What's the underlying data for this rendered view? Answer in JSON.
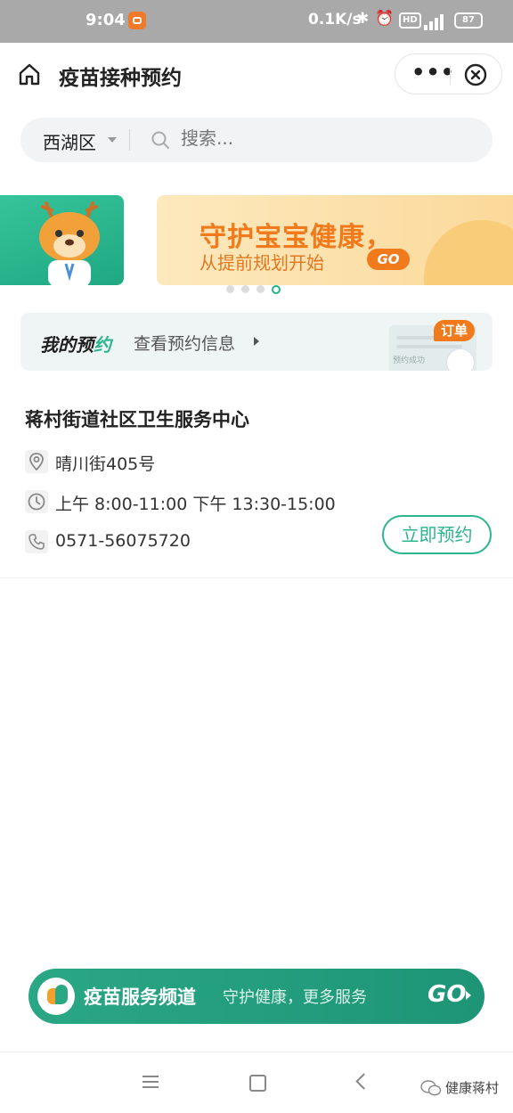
{
  "status_bar": {
    "time": "9:04",
    "network_speed": "0.1K/s",
    "hd": "HD",
    "signal": "4G",
    "battery": "87"
  },
  "header": {
    "title": "疫苗接种预约",
    "more_label": "•••"
  },
  "search": {
    "district": "西湖区",
    "placeholder": "搜索..."
  },
  "banner": {
    "title": "守护宝宝健康，",
    "subtitle": "从提前规划开始",
    "go": "GO",
    "active_slide": 4,
    "total_slides": 4
  },
  "my_appointment": {
    "title_part1": "我的预",
    "title_part2": "约",
    "link": "查看预约信息",
    "badge": "订单",
    "card_text": "预约成功"
  },
  "center": {
    "name": "蒋村街道社区卫生服务中心",
    "address": "晴川街405号",
    "hours": "上午 8:00-11:00  下午 13:30-15:00",
    "phone": "0571-56075720",
    "book_label": "立即预约"
  },
  "channel": {
    "title": "疫苗服务频道",
    "subtitle": "守护健康，更多服务",
    "go": "GO"
  },
  "watermark": "健康蒋村",
  "colors": {
    "accent": "#2cb58f",
    "orange": "#f07a1c",
    "channel_bg": "#2aa785"
  }
}
